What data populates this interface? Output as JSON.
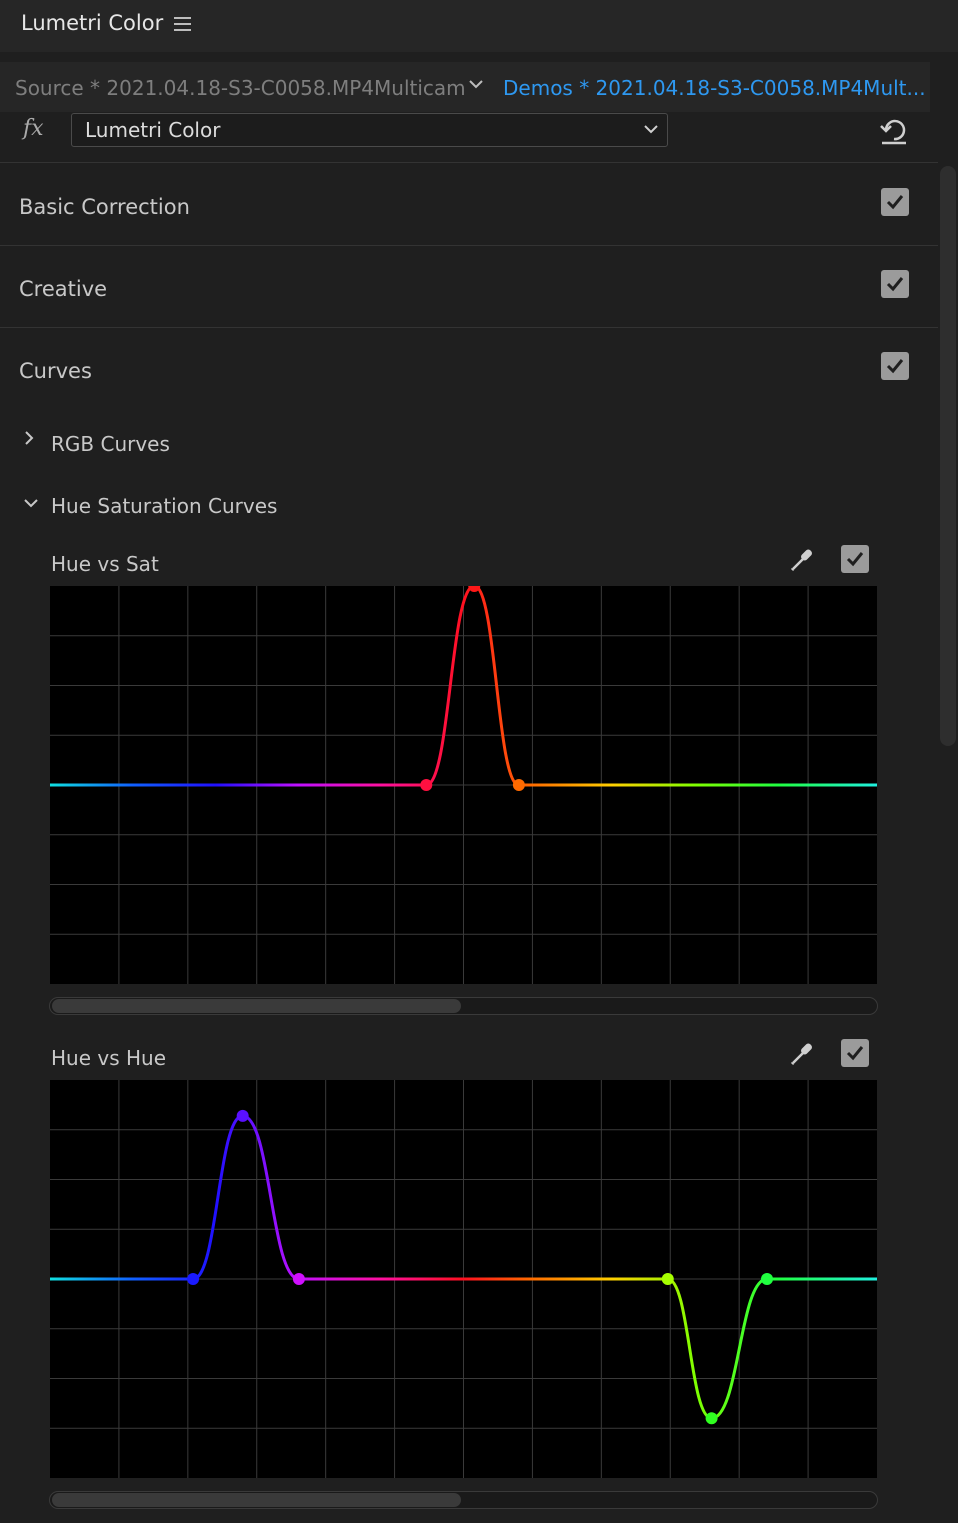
{
  "window": {
    "title": "Lumetri Color"
  },
  "source": {
    "clip_label": "Source * 2021.04.18-S3-C0058.MP4Multicam",
    "sequence_label": "Demos * 2021.04.18-S3-C0058.MP4Mult..."
  },
  "effect": {
    "selected": "Lumetri Color"
  },
  "sections": [
    {
      "label": "Basic Correction",
      "enabled": true
    },
    {
      "label": "Creative",
      "enabled": true
    },
    {
      "label": "Curves",
      "enabled": true
    }
  ],
  "curves": {
    "rgb_curves_label": "RGB Curves",
    "hue_sat_curves_label": "Hue Saturation Curves",
    "hue_vs_sat": {
      "label": "Hue vs Sat",
      "enabled": true,
      "points": [
        {
          "hue": 0.455,
          "value": 0.0,
          "color": "#ff1040"
        },
        {
          "hue": 0.513,
          "value": 0.5,
          "color": "#ff1818"
        },
        {
          "hue": 0.567,
          "value": 0.0,
          "color": "#ff6a00"
        }
      ],
      "scroll_fraction": 0.5
    },
    "hue_vs_hue": {
      "label": "Hue vs Hue",
      "enabled": true,
      "points": [
        {
          "hue": 0.173,
          "value": 0.0,
          "color": "#1a1aff"
        },
        {
          "hue": 0.233,
          "value": 0.41,
          "color": "#5a10ff"
        },
        {
          "hue": 0.301,
          "value": 0.0,
          "color": "#d010ff"
        },
        {
          "hue": 0.747,
          "value": 0.0,
          "color": "#a6ff00"
        },
        {
          "hue": 0.8,
          "value": -0.35,
          "color": "#30ff20"
        },
        {
          "hue": 0.867,
          "value": 0.0,
          "color": "#20ff40"
        }
      ],
      "scroll_fraction": 0.5
    }
  }
}
